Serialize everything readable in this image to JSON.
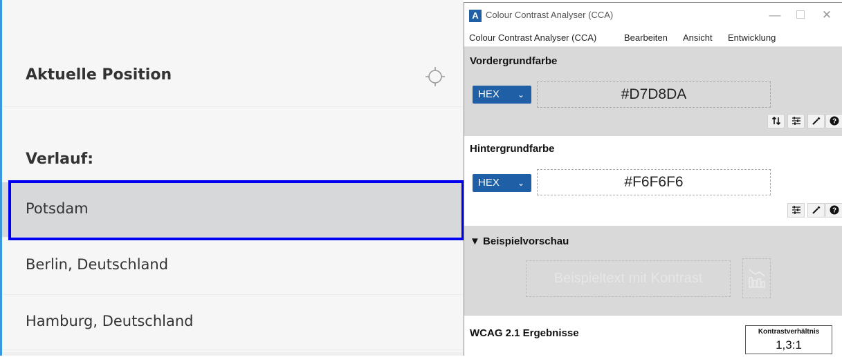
{
  "left_app": {
    "current_position_label": "Aktuelle Position",
    "history_title": "Verlauf:",
    "locations": [
      "Potsdam",
      "Berlin, Deutschland",
      "Hamburg, Deutschland"
    ],
    "selected_location": "Potsdam"
  },
  "cca": {
    "window_title": "Colour Contrast Analyser (CCA)",
    "app_icon_letter": "A",
    "window_controls": {
      "minimize": "—",
      "close": "✕"
    },
    "menu": [
      "Colour Contrast Analyser (CCA)",
      "Bearbeiten",
      "Ansicht",
      "Entwicklung"
    ],
    "foreground": {
      "heading": "Vordergrundfarbe",
      "format": "HEX",
      "value": "#D7D8DA",
      "color": "#d7d8da",
      "tools": [
        "swap-icon",
        "sliders-icon",
        "eyedropper-icon",
        "help-icon"
      ]
    },
    "background": {
      "heading": "Hintergrundfarbe",
      "format": "HEX",
      "value": "#F6F6F6",
      "color": "#f6f6f6",
      "tools": [
        "sliders-icon",
        "eyedropper-icon",
        "help-icon"
      ]
    },
    "preview": {
      "heading": "▼ Beispielvorschau",
      "sample_text": "Beispieltext mit Kontrast"
    },
    "wcag": {
      "heading": "WCAG 2.1 Ergebnisse",
      "ratio_label": "Kontrastverhältnis",
      "ratio_value": "1,3:1"
    }
  },
  "colors": {
    "highlight_border": "#0000f0",
    "select_blue": "#1f5fa6",
    "selected_row_bg": "#d7d8da",
    "list_bg": "#f6f6f6"
  }
}
